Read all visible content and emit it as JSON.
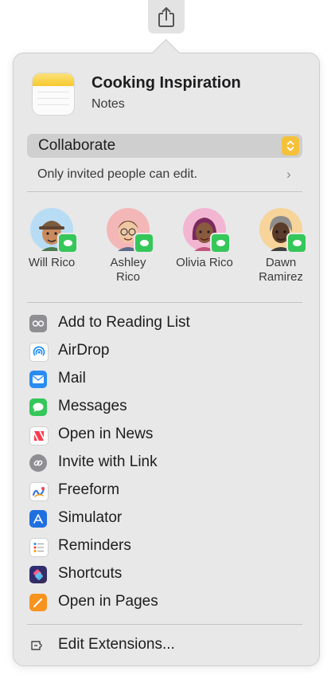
{
  "app": {
    "title": "Cooking Inspiration",
    "subtitle": "Notes"
  },
  "collaboration": {
    "mode": "Collaborate",
    "permission": "Only invited people can edit.",
    "accent": "#f5c13a"
  },
  "people": [
    {
      "name_line1": "Will Rico",
      "name_line2": "",
      "icon": "memoji-will",
      "bg": "#b9dcf5"
    },
    {
      "name_line1": "Ashley",
      "name_line2": "Rico",
      "icon": "memoji-ashley",
      "bg": "#f4b7b7"
    },
    {
      "name_line1": "Olivia Rico",
      "name_line2": "",
      "icon": "memoji-olivia",
      "bg": "#f3b6d2"
    },
    {
      "name_line1": "Dawn",
      "name_line2": "Ramirez",
      "icon": "memoji-dawn",
      "bg": "#f7d49a"
    }
  ],
  "menu": [
    {
      "label": "Add to Reading List",
      "icon": "reading-list-icon"
    },
    {
      "label": "AirDrop",
      "icon": "airdrop-icon"
    },
    {
      "label": "Mail",
      "icon": "mail-icon"
    },
    {
      "label": "Messages",
      "icon": "messages-icon"
    },
    {
      "label": "Open in News",
      "icon": "news-icon"
    },
    {
      "label": "Invite with Link",
      "icon": "link-icon"
    },
    {
      "label": "Freeform",
      "icon": "freeform-icon"
    },
    {
      "label": "Simulator",
      "icon": "simulator-icon"
    },
    {
      "label": "Reminders",
      "icon": "reminders-icon"
    },
    {
      "label": "Shortcuts",
      "icon": "shortcuts-icon"
    },
    {
      "label": "Open in Pages",
      "icon": "pages-icon"
    }
  ],
  "footer": {
    "label": "Edit Extensions...",
    "icon": "extensions-icon"
  }
}
